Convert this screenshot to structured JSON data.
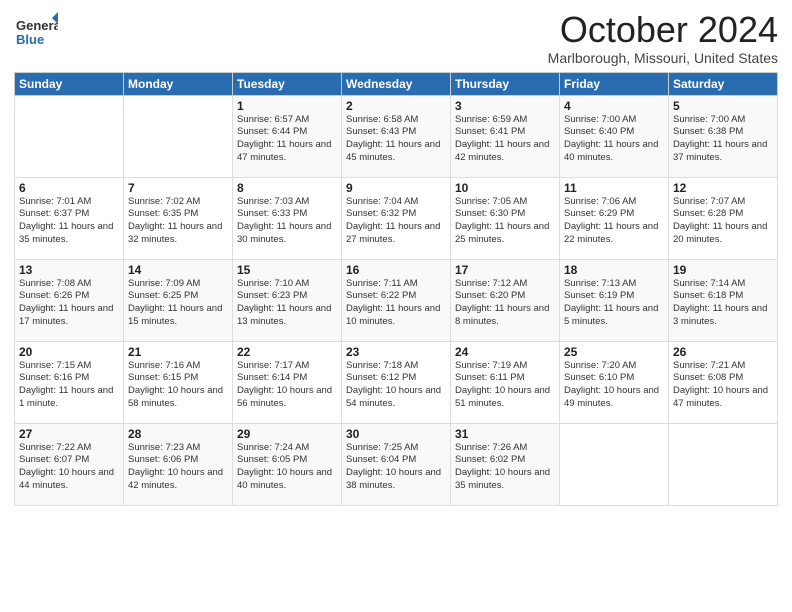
{
  "logo": {
    "general": "General",
    "blue": "Blue"
  },
  "header": {
    "month_title": "October 2024",
    "location": "Marlborough, Missouri, United States"
  },
  "days_of_week": [
    "Sunday",
    "Monday",
    "Tuesday",
    "Wednesday",
    "Thursday",
    "Friday",
    "Saturday"
  ],
  "weeks": [
    [
      {
        "day": "",
        "info": ""
      },
      {
        "day": "",
        "info": ""
      },
      {
        "day": "1",
        "info": "Sunrise: 6:57 AM\nSunset: 6:44 PM\nDaylight: 11 hours and 47 minutes."
      },
      {
        "day": "2",
        "info": "Sunrise: 6:58 AM\nSunset: 6:43 PM\nDaylight: 11 hours and 45 minutes."
      },
      {
        "day": "3",
        "info": "Sunrise: 6:59 AM\nSunset: 6:41 PM\nDaylight: 11 hours and 42 minutes."
      },
      {
        "day": "4",
        "info": "Sunrise: 7:00 AM\nSunset: 6:40 PM\nDaylight: 11 hours and 40 minutes."
      },
      {
        "day": "5",
        "info": "Sunrise: 7:00 AM\nSunset: 6:38 PM\nDaylight: 11 hours and 37 minutes."
      }
    ],
    [
      {
        "day": "6",
        "info": "Sunrise: 7:01 AM\nSunset: 6:37 PM\nDaylight: 11 hours and 35 minutes."
      },
      {
        "day": "7",
        "info": "Sunrise: 7:02 AM\nSunset: 6:35 PM\nDaylight: 11 hours and 32 minutes."
      },
      {
        "day": "8",
        "info": "Sunrise: 7:03 AM\nSunset: 6:33 PM\nDaylight: 11 hours and 30 minutes."
      },
      {
        "day": "9",
        "info": "Sunrise: 7:04 AM\nSunset: 6:32 PM\nDaylight: 11 hours and 27 minutes."
      },
      {
        "day": "10",
        "info": "Sunrise: 7:05 AM\nSunset: 6:30 PM\nDaylight: 11 hours and 25 minutes."
      },
      {
        "day": "11",
        "info": "Sunrise: 7:06 AM\nSunset: 6:29 PM\nDaylight: 11 hours and 22 minutes."
      },
      {
        "day": "12",
        "info": "Sunrise: 7:07 AM\nSunset: 6:28 PM\nDaylight: 11 hours and 20 minutes."
      }
    ],
    [
      {
        "day": "13",
        "info": "Sunrise: 7:08 AM\nSunset: 6:26 PM\nDaylight: 11 hours and 17 minutes."
      },
      {
        "day": "14",
        "info": "Sunrise: 7:09 AM\nSunset: 6:25 PM\nDaylight: 11 hours and 15 minutes."
      },
      {
        "day": "15",
        "info": "Sunrise: 7:10 AM\nSunset: 6:23 PM\nDaylight: 11 hours and 13 minutes."
      },
      {
        "day": "16",
        "info": "Sunrise: 7:11 AM\nSunset: 6:22 PM\nDaylight: 11 hours and 10 minutes."
      },
      {
        "day": "17",
        "info": "Sunrise: 7:12 AM\nSunset: 6:20 PM\nDaylight: 11 hours and 8 minutes."
      },
      {
        "day": "18",
        "info": "Sunrise: 7:13 AM\nSunset: 6:19 PM\nDaylight: 11 hours and 5 minutes."
      },
      {
        "day": "19",
        "info": "Sunrise: 7:14 AM\nSunset: 6:18 PM\nDaylight: 11 hours and 3 minutes."
      }
    ],
    [
      {
        "day": "20",
        "info": "Sunrise: 7:15 AM\nSunset: 6:16 PM\nDaylight: 11 hours and 1 minute."
      },
      {
        "day": "21",
        "info": "Sunrise: 7:16 AM\nSunset: 6:15 PM\nDaylight: 10 hours and 58 minutes."
      },
      {
        "day": "22",
        "info": "Sunrise: 7:17 AM\nSunset: 6:14 PM\nDaylight: 10 hours and 56 minutes."
      },
      {
        "day": "23",
        "info": "Sunrise: 7:18 AM\nSunset: 6:12 PM\nDaylight: 10 hours and 54 minutes."
      },
      {
        "day": "24",
        "info": "Sunrise: 7:19 AM\nSunset: 6:11 PM\nDaylight: 10 hours and 51 minutes."
      },
      {
        "day": "25",
        "info": "Sunrise: 7:20 AM\nSunset: 6:10 PM\nDaylight: 10 hours and 49 minutes."
      },
      {
        "day": "26",
        "info": "Sunrise: 7:21 AM\nSunset: 6:08 PM\nDaylight: 10 hours and 47 minutes."
      }
    ],
    [
      {
        "day": "27",
        "info": "Sunrise: 7:22 AM\nSunset: 6:07 PM\nDaylight: 10 hours and 44 minutes."
      },
      {
        "day": "28",
        "info": "Sunrise: 7:23 AM\nSunset: 6:06 PM\nDaylight: 10 hours and 42 minutes."
      },
      {
        "day": "29",
        "info": "Sunrise: 7:24 AM\nSunset: 6:05 PM\nDaylight: 10 hours and 40 minutes."
      },
      {
        "day": "30",
        "info": "Sunrise: 7:25 AM\nSunset: 6:04 PM\nDaylight: 10 hours and 38 minutes."
      },
      {
        "day": "31",
        "info": "Sunrise: 7:26 AM\nSunset: 6:02 PM\nDaylight: 10 hours and 35 minutes."
      },
      {
        "day": "",
        "info": ""
      },
      {
        "day": "",
        "info": ""
      }
    ]
  ]
}
